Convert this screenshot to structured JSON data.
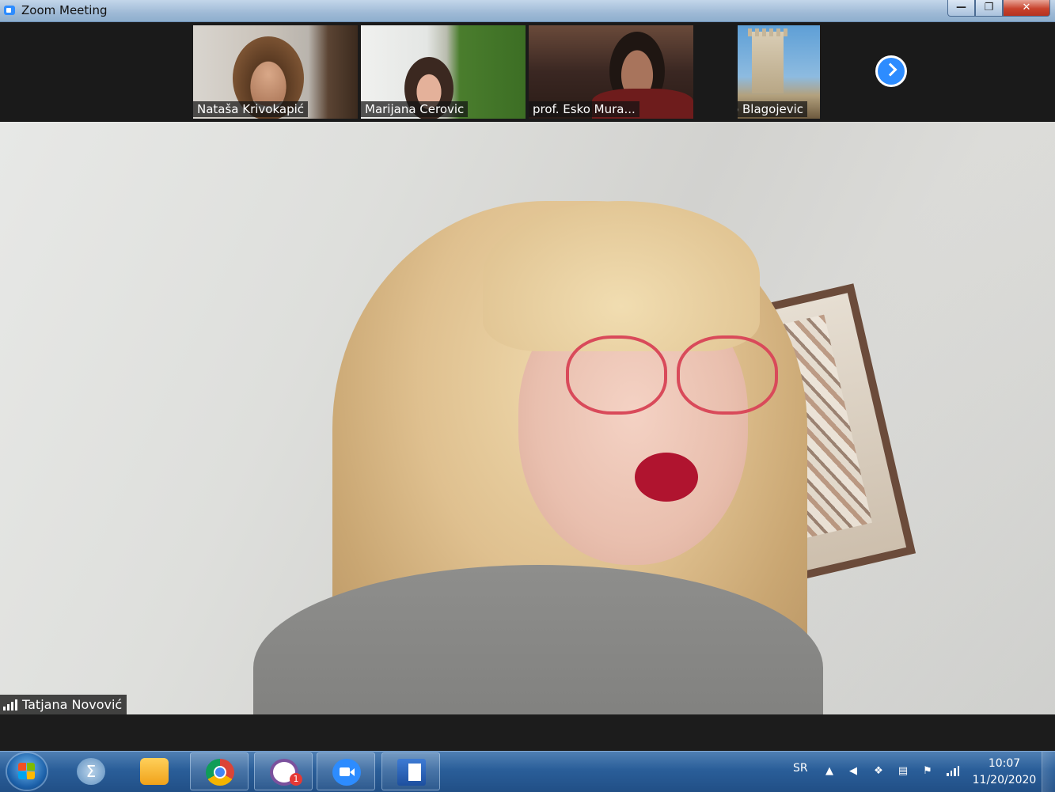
{
  "window": {
    "title": "Zoom Meeting",
    "minimize": "—",
    "restore": "❐",
    "close": "✕"
  },
  "thumbnails": [
    {
      "name": "Nataša Krivokapić"
    },
    {
      "name": "Marijana Cerovic"
    },
    {
      "name": "prof. Esko Mura..."
    },
    {
      "name": "Darko Blagojevic"
    }
  ],
  "main_speaker": {
    "name": "Tatjana Novović"
  },
  "taskbar": {
    "apps": [
      {
        "icon": "sigma-icon"
      },
      {
        "icon": "outlook-icon"
      },
      {
        "icon": "chrome-icon"
      },
      {
        "icon": "viber-icon",
        "badge": "1"
      },
      {
        "icon": "zoom-icon"
      },
      {
        "icon": "word-icon"
      }
    ],
    "language": "SR",
    "time": "10:07",
    "date": "11/20/2020"
  }
}
